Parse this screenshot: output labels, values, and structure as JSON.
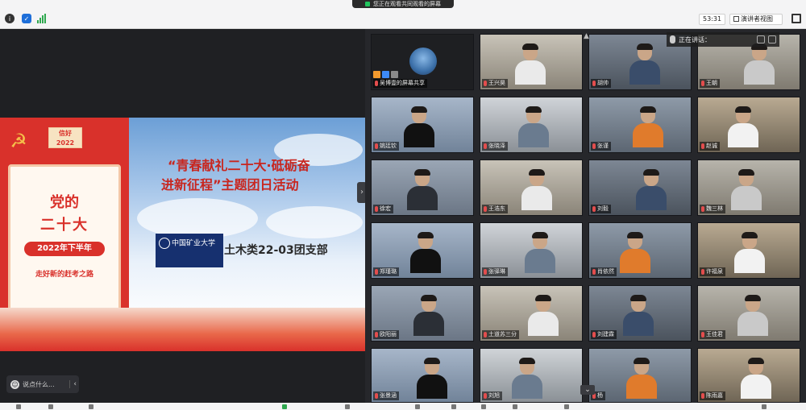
{
  "app": {
    "share_banner": "您正在观看共同观看的屏幕",
    "timer": "53:31",
    "view_button": "演讲者视图",
    "colors": {
      "accent_green": "#22c55e",
      "bg_dark": "#1f2023",
      "party_red": "#d9312b"
    }
  },
  "icons": {
    "info": "info-icon",
    "shield": "shield-icon",
    "signal": "signal-icon",
    "fullscreen": "fullscreen-icon"
  },
  "slide": {
    "year_badge_line1": "信好",
    "year_badge_line2": "2022",
    "card_title1": "党的",
    "card_title2": "二十大",
    "card_pill": "2022年下半年",
    "card_sub": "走好新的赶考之路",
    "title_line1": "“青春献礼二十大·砥砺奋",
    "title_line2": "进新征程”主题团日活动",
    "univ_logo_text": "中国矿业大学",
    "branch_name": "土木类22-03团支部"
  },
  "chat": {
    "placeholder": "说点什么...",
    "collapse_arrow": "‹"
  },
  "speaking_label": "正在讲话：",
  "grid": {
    "tiles": [
      {
        "name": "吴博壹的屏幕共享",
        "type": "share"
      },
      {
        "name": "王兴昊",
        "type": "person"
      },
      {
        "name": "胡帅",
        "type": "person"
      },
      {
        "name": "王朝",
        "type": "person"
      },
      {
        "name": "姚廷钦",
        "type": "person"
      },
      {
        "name": "张晓泽",
        "type": "person"
      },
      {
        "name": "张谨",
        "type": "person"
      },
      {
        "name": "赵诚",
        "type": "person"
      },
      {
        "name": "徐宏",
        "type": "person"
      },
      {
        "name": "王浩东",
        "type": "person"
      },
      {
        "name": "刘毅",
        "type": "person"
      },
      {
        "name": "魏三林",
        "type": "person"
      },
      {
        "name": "郑瑾璐",
        "type": "person"
      },
      {
        "name": "张驿琳",
        "type": "person"
      },
      {
        "name": "肖依然",
        "type": "person"
      },
      {
        "name": "许福泉",
        "type": "person"
      },
      {
        "name": "欧阳丽",
        "type": "person"
      },
      {
        "name": "土道苏三分",
        "type": "person"
      },
      {
        "name": "刘建霖",
        "type": "person"
      },
      {
        "name": "王佳君",
        "type": "person"
      },
      {
        "name": "张景涵",
        "type": "person"
      },
      {
        "name": "刘旭",
        "type": "person"
      },
      {
        "name": "杨",
        "type": "person"
      },
      {
        "name": "陈雨嘉",
        "type": "person"
      }
    ]
  }
}
